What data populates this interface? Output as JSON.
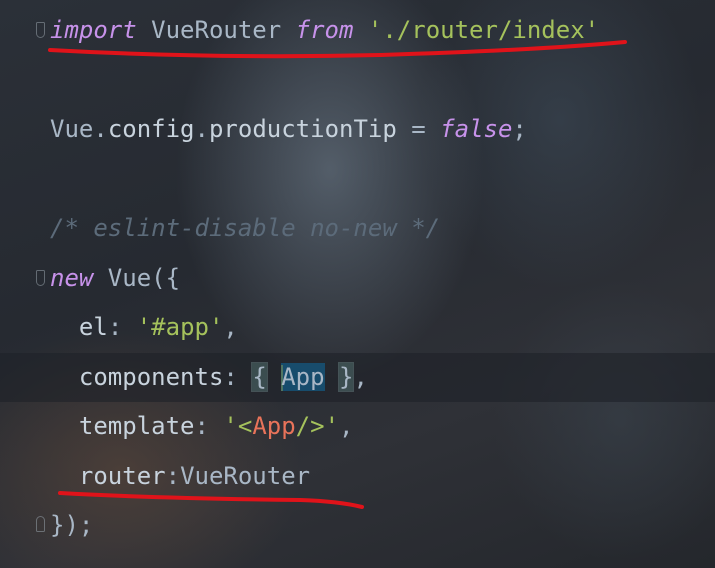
{
  "editor": {
    "lines": {
      "l1": {
        "keyword": "import",
        "name": "VueRouter",
        "from": "from",
        "path": "'./router/index'"
      },
      "l3": {
        "object": "Vue",
        "dot1": ".",
        "config": "config",
        "dot2": ".",
        "prop": "productionTip",
        "eq": " = ",
        "value": "false",
        "semi": ";"
      },
      "l5": {
        "comment": "/* eslint-disable no-new */"
      },
      "l6": {
        "keyword": "new",
        "call": " Vue({"
      },
      "l7": {
        "key": "el",
        "colon": ": ",
        "value": "'#app'",
        "comma": ","
      },
      "l8": {
        "key": "components",
        "colon": ": ",
        "brace_open": "{",
        "app": "App",
        "brace_close": "}",
        "comma": ","
      },
      "l9": {
        "key": "template",
        "colon": ": ",
        "q1": "'<",
        "tag": "App",
        "q2": "/>'",
        "comma": ","
      },
      "l10": {
        "key": "router",
        "colon": ":",
        "value": "VueRouter"
      },
      "l11": {
        "close": "});"
      }
    },
    "colors": {
      "keyword": "#c792ea",
      "string": "#a5c25c",
      "comment": "#5c6b7a",
      "tag": "#e8735a",
      "caret": "#ffc107",
      "annotation": "#e0131a"
    }
  }
}
